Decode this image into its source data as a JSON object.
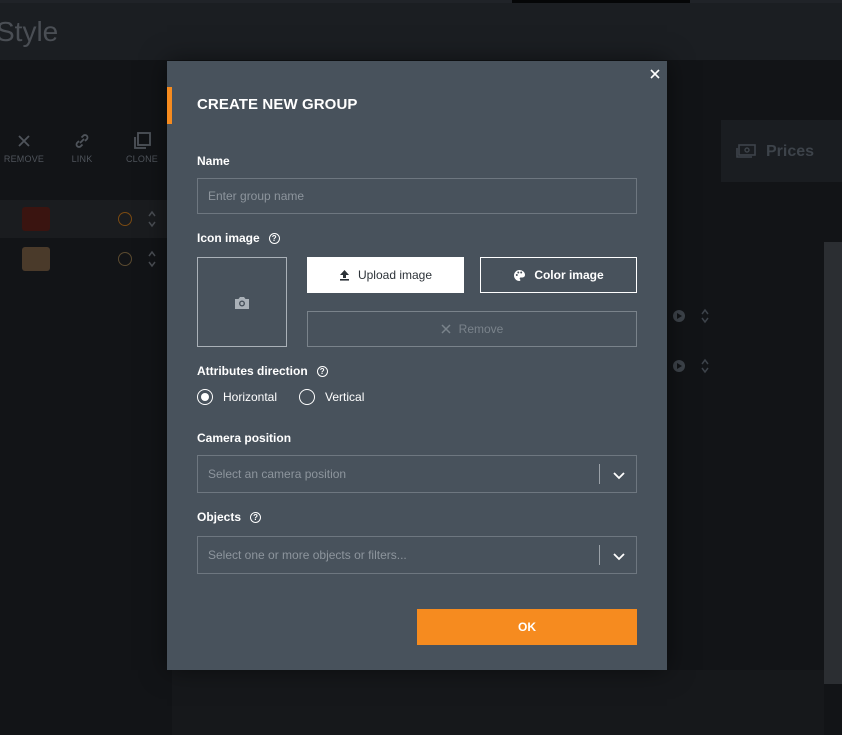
{
  "background": {
    "page_title": "Style",
    "toolbar": [
      {
        "label": "REMOVE",
        "icon": "close-icon"
      },
      {
        "label": "LINK",
        "icon": "link-icon"
      },
      {
        "label": "CLONE",
        "icon": "clone-icon"
      }
    ],
    "prices_tab": "Prices"
  },
  "modal": {
    "title": "CREATE NEW GROUP",
    "name_label": "Name",
    "name_placeholder": "Enter group name",
    "icon_image_label": "Icon image",
    "upload_button": "Upload image",
    "color_button": "Color image",
    "remove_button": "Remove",
    "attributes_direction_label": "Attributes direction",
    "direction_options": [
      {
        "label": "Horizontal",
        "selected": true
      },
      {
        "label": "Vertical",
        "selected": false
      }
    ],
    "camera_position_label": "Camera position",
    "camera_position_placeholder": "Select an camera position",
    "objects_label": "Objects",
    "objects_placeholder": "Select one or more objects or filters...",
    "ok_button": "OK"
  },
  "colors": {
    "accent": "#f68b1f",
    "modal_bg": "#48525c",
    "app_bg": "#121417"
  }
}
